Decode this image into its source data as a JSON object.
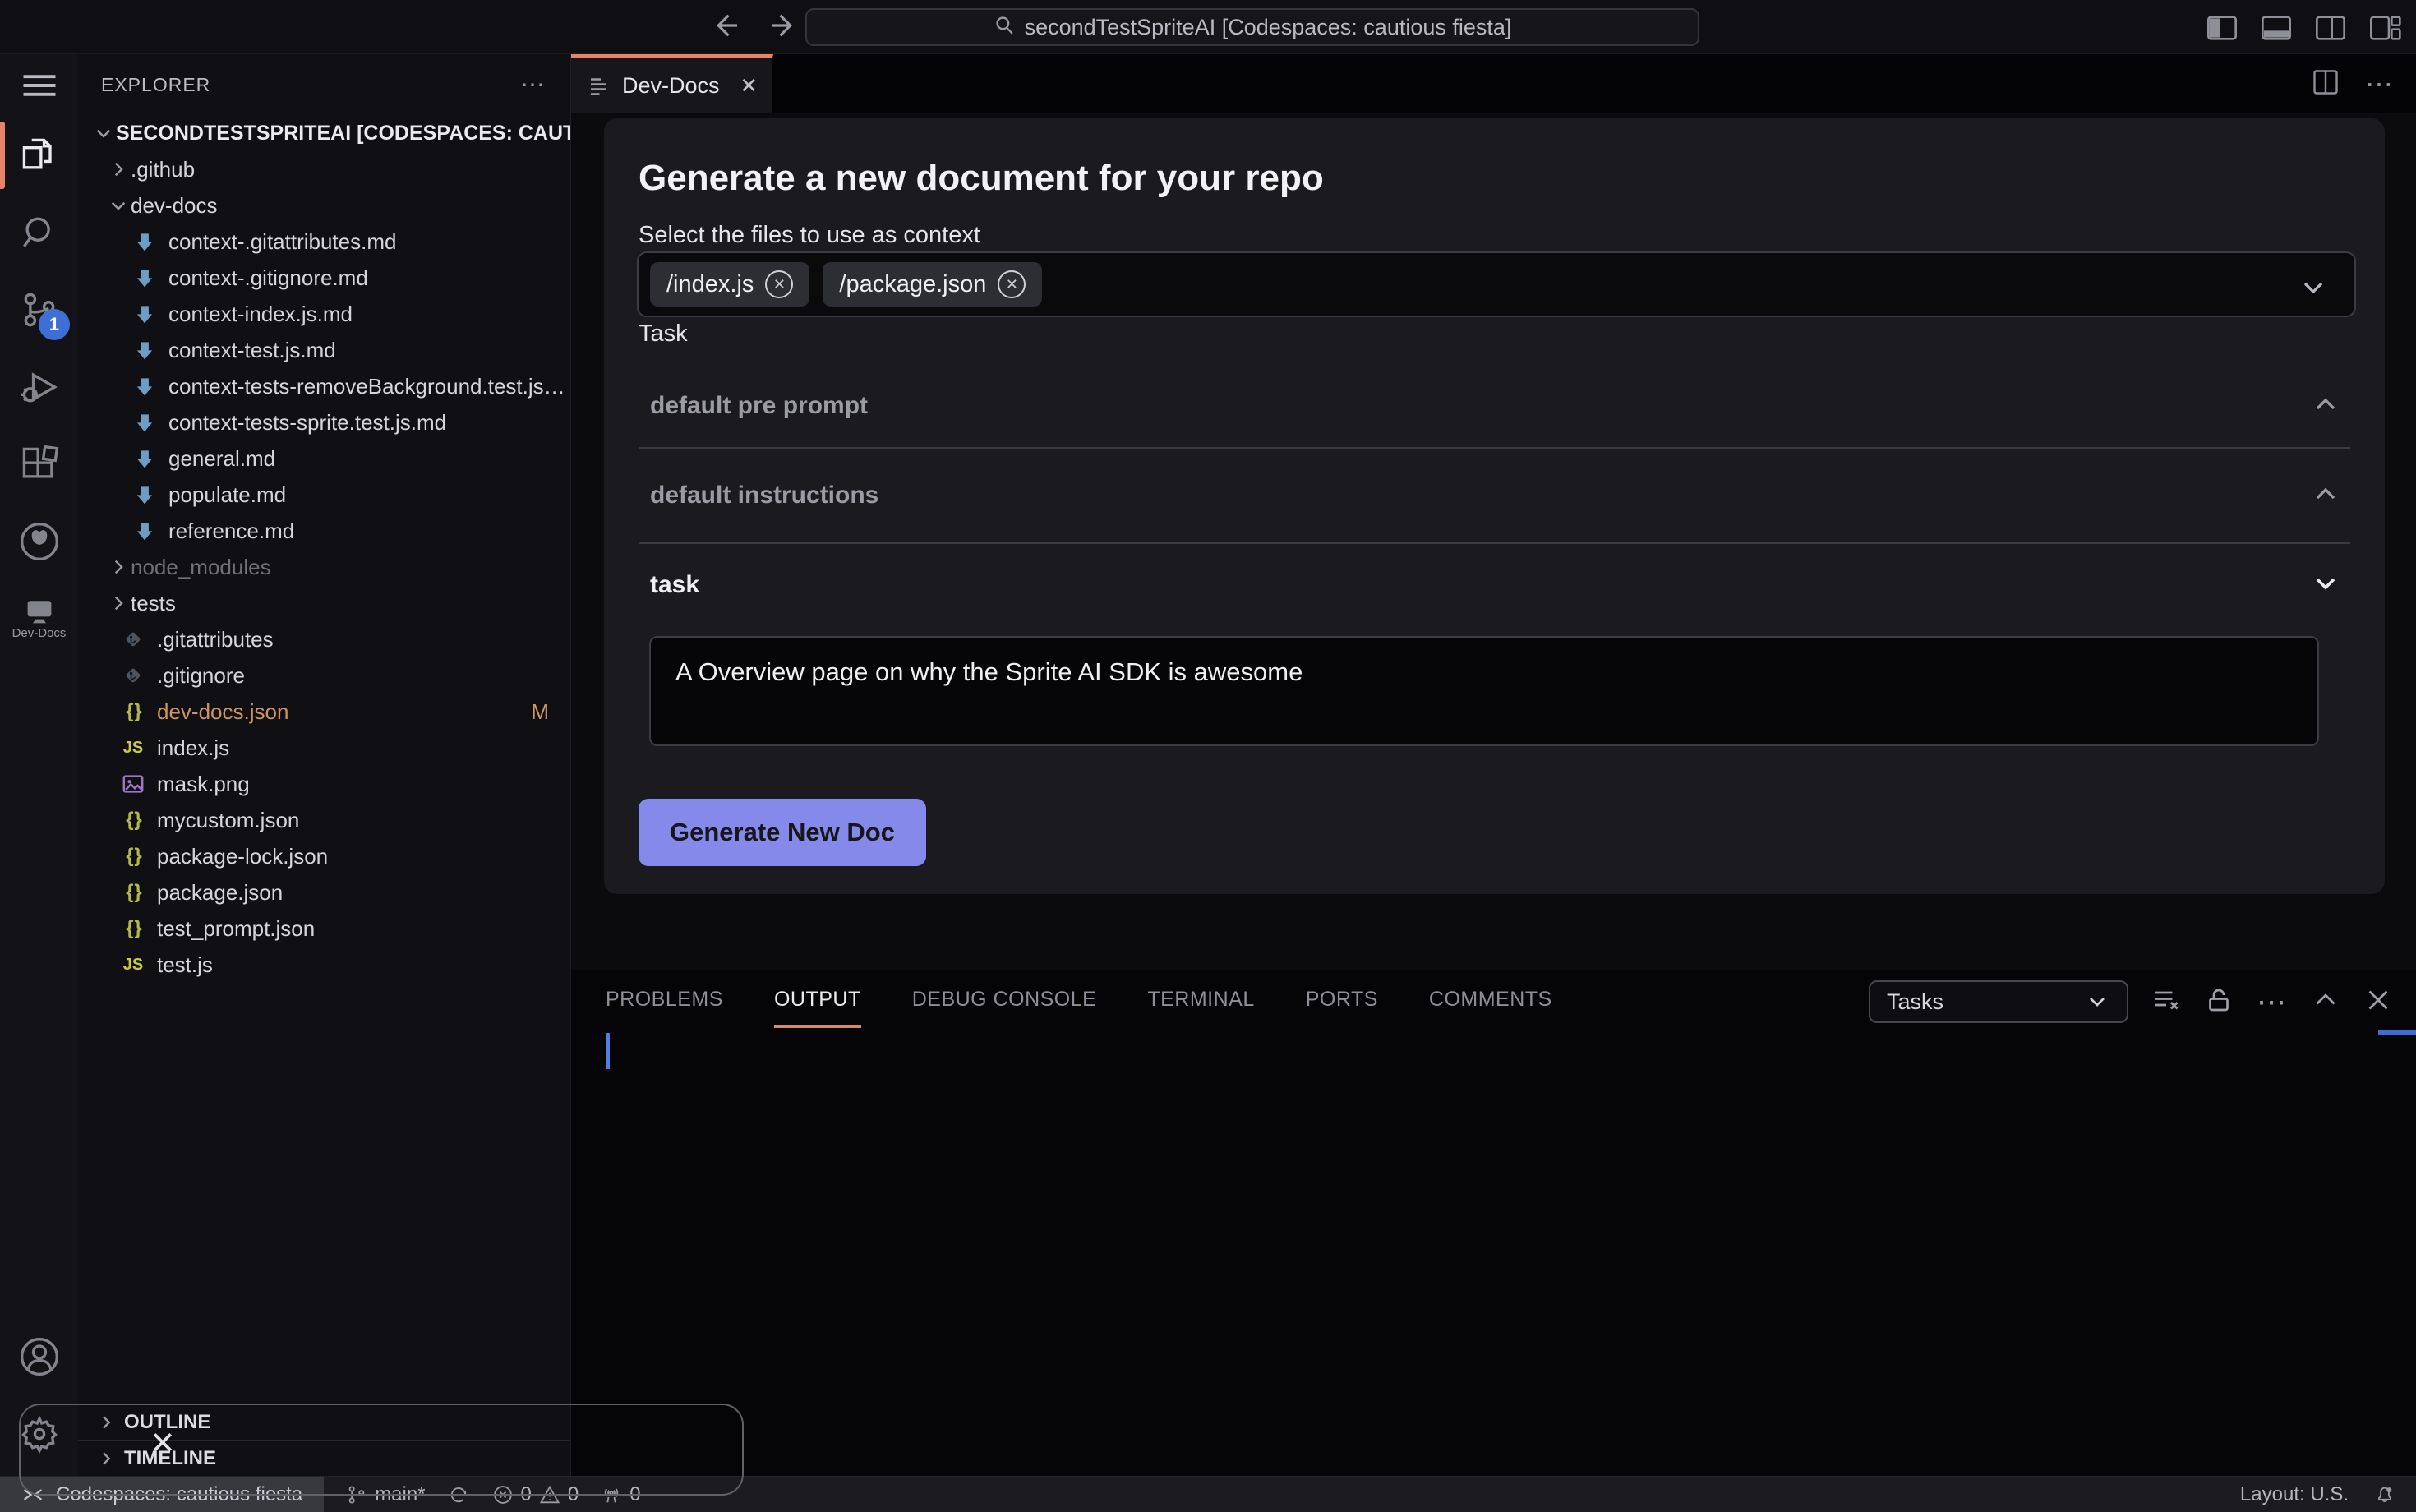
{
  "titlebar": {
    "search_text": "secondTestSpriteAI [Codespaces: cautious fiesta]"
  },
  "activity_bar": {
    "scm_badge": "1",
    "devdocs_label": "Dev-Docs"
  },
  "explorer": {
    "header": "EXPLORER",
    "kebab": "⋯",
    "outline": "OUTLINE",
    "timeline": "TIMELINE",
    "tree": [
      {
        "label": "SECONDTESTSPRITEAI [CODESPACES: CAUTIO…",
        "icon": "chevron-down",
        "level": 0,
        "bold": true
      },
      {
        "label": ".github",
        "icon": "chevron-right",
        "level": 1
      },
      {
        "label": "dev-docs",
        "icon": "chevron-down",
        "level": 1
      },
      {
        "label": "context-.gitattributes.md",
        "icon": "md",
        "level": 2
      },
      {
        "label": "context-.gitignore.md",
        "icon": "md",
        "level": 2
      },
      {
        "label": "context-index.js.md",
        "icon": "md",
        "level": 2
      },
      {
        "label": "context-test.js.md",
        "icon": "md",
        "level": 2
      },
      {
        "label": "context-tests-removeBackground.test.js…",
        "icon": "md",
        "level": 2
      },
      {
        "label": "context-tests-sprite.test.js.md",
        "icon": "md",
        "level": 2
      },
      {
        "label": "general.md",
        "icon": "md",
        "level": 2
      },
      {
        "label": "populate.md",
        "icon": "md",
        "level": 2
      },
      {
        "label": "reference.md",
        "icon": "md",
        "level": 2
      },
      {
        "label": "node_modules",
        "icon": "chevron-right",
        "level": 1,
        "dim": true
      },
      {
        "label": "tests",
        "icon": "chevron-right",
        "level": 1
      },
      {
        "label": ".gitattributes",
        "icon": "git",
        "level": "file"
      },
      {
        "label": ".gitignore",
        "icon": "git",
        "level": "file"
      },
      {
        "label": "dev-docs.json",
        "icon": "json",
        "level": "file",
        "modified": true,
        "badge": "M"
      },
      {
        "label": "index.js",
        "icon": "js",
        "level": "file"
      },
      {
        "label": "mask.png",
        "icon": "image",
        "level": "file"
      },
      {
        "label": "mycustom.json",
        "icon": "json",
        "level": "file"
      },
      {
        "label": "package-lock.json",
        "icon": "json",
        "level": "file"
      },
      {
        "label": "package.json",
        "icon": "json",
        "level": "file"
      },
      {
        "label": "test_prompt.json",
        "icon": "json",
        "level": "file"
      },
      {
        "label": "test.js",
        "icon": "js",
        "level": "file"
      }
    ]
  },
  "editor": {
    "tab_label": "Dev-Docs",
    "tab_close": "✕"
  },
  "form": {
    "heading": "Generate a new document for your repo",
    "context_label": "Select the files to use as context",
    "chips": [
      {
        "label": "/index.js"
      },
      {
        "label": "/package.json"
      }
    ],
    "task_label": "Task",
    "sections": [
      {
        "label": "default pre prompt",
        "chevron": "up"
      },
      {
        "label": "default instructions",
        "chevron": "up"
      },
      {
        "label": "task",
        "chevron": "down",
        "active": true
      }
    ],
    "task_value": "A Overview page on why the Sprite AI SDK is awesome",
    "generate_button": "Generate New Doc"
  },
  "panel": {
    "tabs": [
      {
        "label": "PROBLEMS"
      },
      {
        "label": "OUTPUT",
        "active": true
      },
      {
        "label": "DEBUG CONSOLE"
      },
      {
        "label": "TERMINAL"
      },
      {
        "label": "PORTS"
      },
      {
        "label": "COMMENTS"
      }
    ],
    "tasks_dropdown": "Tasks",
    "more_dots": "⋯"
  },
  "status_bar": {
    "remote": "Codespaces: cautious fiesta",
    "branch": "main*",
    "errors": "0",
    "warnings": "0",
    "ports": "0",
    "layout": "Layout: U.S."
  },
  "overlay": {
    "close_glyph": "✕"
  },
  "colors": {
    "accent_orange": "#e8836b",
    "button_indigo": "#8589ea",
    "badge_blue": "#3f6fd6",
    "md_blue": "#6d9cc5",
    "json_yellow": "#b5b94d",
    "js_yellow": "#cbcb41",
    "modified_orange": "#cf9560",
    "image_purple": "#a074c4",
    "caret_blue": "#4d7fe0"
  }
}
